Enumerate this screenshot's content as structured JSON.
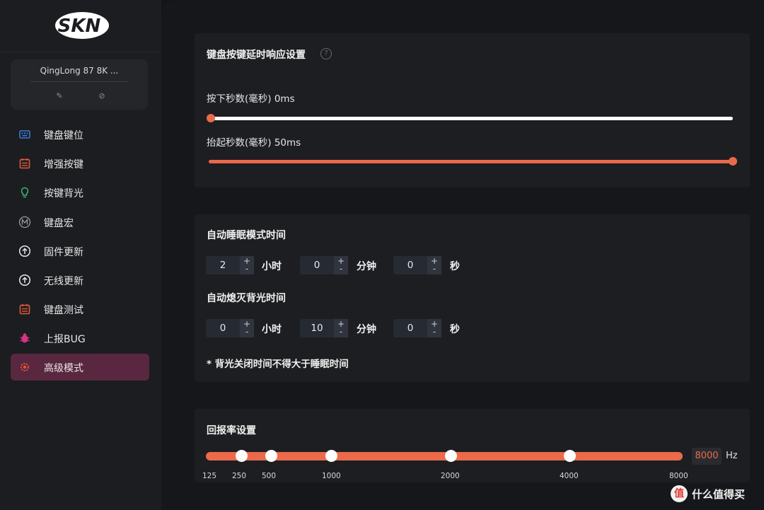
{
  "sidebar": {
    "logo_text": "SKN",
    "device": {
      "name": "QingLong 87 8K ..."
    },
    "items": [
      {
        "label": "键盘键位",
        "icon": "keyboard-icon",
        "color": "#3a7bd5"
      },
      {
        "label": "增强按键",
        "icon": "enhance-key-icon",
        "color": "#e0583d"
      },
      {
        "label": "按键背光",
        "icon": "lightbulb-icon",
        "color": "#3bb27a"
      },
      {
        "label": "键盘宏",
        "icon": "macro-icon",
        "color": "#9a9a9e"
      },
      {
        "label": "固件更新",
        "icon": "firmware-update-icon",
        "color": "#e6e6e6"
      },
      {
        "label": "无线更新",
        "icon": "wireless-update-icon",
        "color": "#e6e6e6"
      },
      {
        "label": "键盘测试",
        "icon": "keyboard-test-icon",
        "color": "#e0583d"
      },
      {
        "label": "上报BUG",
        "icon": "bug-icon",
        "color": "#d63384"
      },
      {
        "label": "高级模式",
        "icon": "advanced-gear-icon",
        "color": "#e0583d",
        "active": true
      }
    ]
  },
  "delay_panel": {
    "title": "键盘按键延时响应设置",
    "help": "?",
    "press": {
      "label": "按下秒数(毫秒) 0ms",
      "value_ms": 0,
      "fraction": 0.0
    },
    "release": {
      "label": "抬起秒数(毫秒) 50ms",
      "value_ms": 50,
      "fraction": 1.0
    }
  },
  "sleep_panel": {
    "sleep_title": "自动睡眠模式时间",
    "sleep": {
      "hours": "2",
      "minutes": "0",
      "seconds": "0"
    },
    "backlight_title": "自动熄灭背光时间",
    "backlight": {
      "hours": "0",
      "minutes": "10",
      "seconds": "0"
    },
    "units": {
      "hour": "小时",
      "minute": "分钟",
      "second": "秒"
    },
    "plus": "+",
    "minus": "-",
    "note": "* 背光关闭时间不得大于睡眠时间"
  },
  "rate_panel": {
    "title": "回报率设置",
    "ticks": [
      "125",
      "250",
      "500",
      "1000",
      "2000",
      "4000",
      "8000"
    ],
    "value": "8000",
    "unit": "Hz"
  },
  "watermark": {
    "badge": "值",
    "text": "什么值得买"
  },
  "colors": {
    "accent": "#ea6a4b",
    "active_nav": "#5a2740"
  }
}
